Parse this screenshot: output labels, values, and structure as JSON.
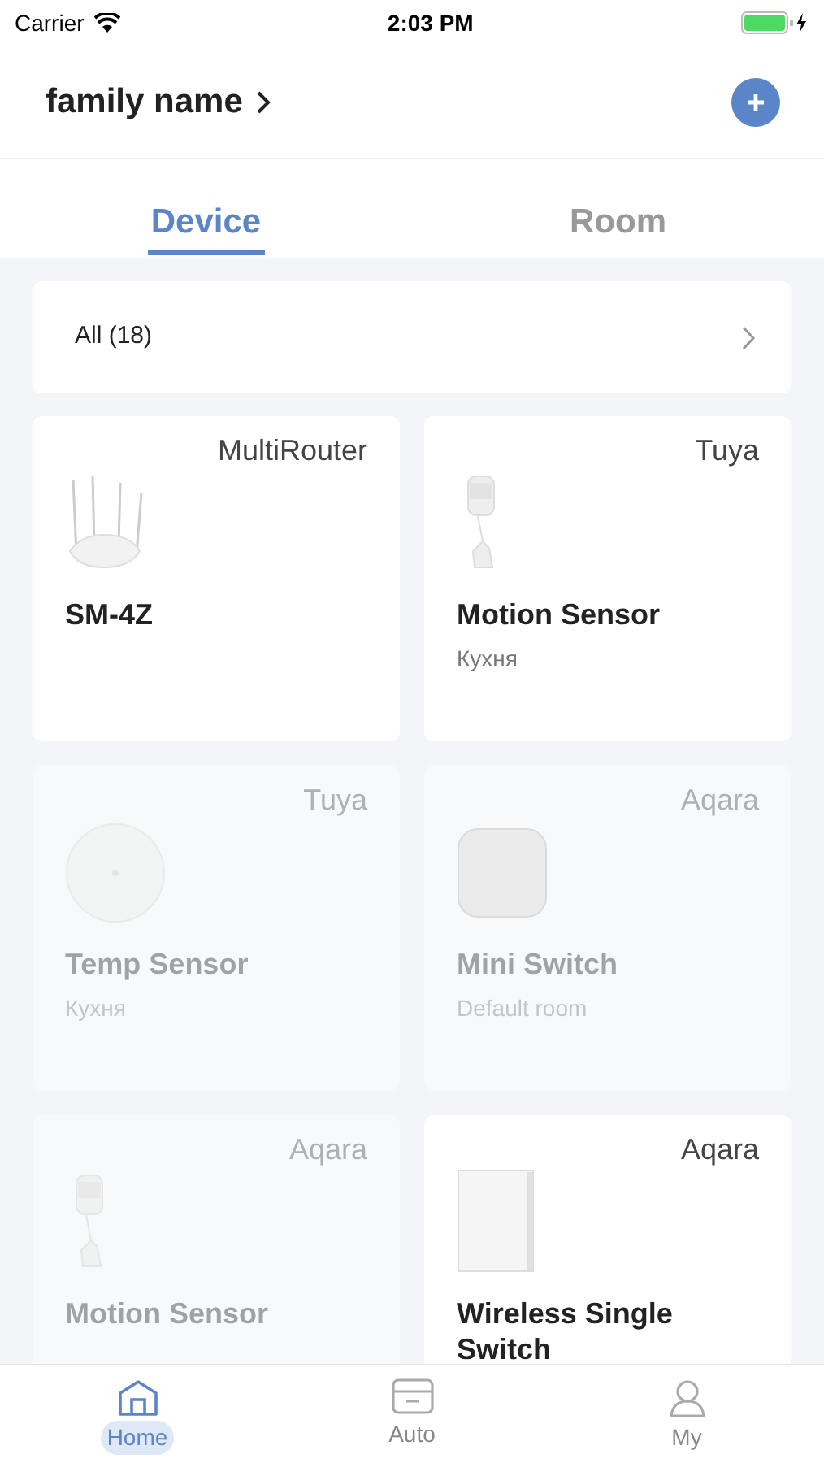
{
  "status_bar": {
    "carrier": "Carrier",
    "time": "2:03 PM"
  },
  "header": {
    "title": "family name"
  },
  "tabs": [
    {
      "label": "Device",
      "selected": true
    },
    {
      "label": "Room",
      "selected": false
    }
  ],
  "filter": {
    "label": "All (18)"
  },
  "devices": [
    {
      "brand": "MultiRouter",
      "name": "SM-4Z",
      "kind": "router",
      "online": true
    },
    {
      "brand": "Tuya",
      "name": "Motion Sensor",
      "room": "Кухня",
      "kind": "motion",
      "online": true
    },
    {
      "brand": "Tuya",
      "name": "Temp Sensor",
      "room": "Кухня",
      "kind": "round",
      "online": false
    },
    {
      "brand": "Aqara",
      "name": "Mini Switch",
      "room": "Default room",
      "kind": "square",
      "online": false
    },
    {
      "brand": "Aqara",
      "name": "Motion Sensor",
      "kind": "motion",
      "online": false
    },
    {
      "brand": "Aqara",
      "name": "Wireless Single Switch",
      "kind": "wallswitch",
      "online": true
    }
  ],
  "bottom_nav": [
    {
      "label": "Home",
      "selected": true
    },
    {
      "label": "Auto",
      "selected": false
    },
    {
      "label": "My",
      "selected": false
    }
  ]
}
